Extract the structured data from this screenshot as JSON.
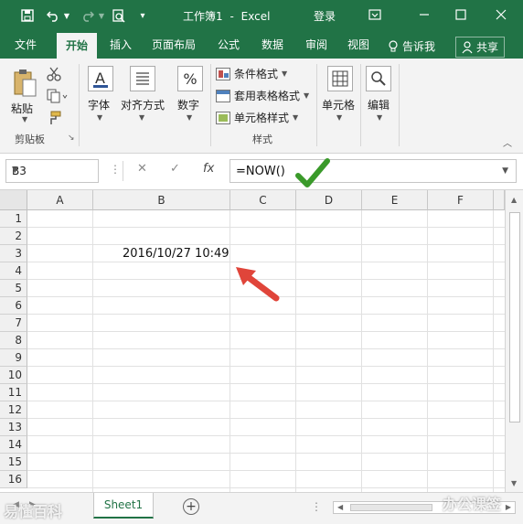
{
  "title_bar": {
    "doc_title": "工作簿1",
    "separator": "-",
    "app_name": "Excel",
    "login": "登录",
    "bg_color": "#217346"
  },
  "tabs": [
    {
      "label": "文件"
    },
    {
      "label": "开始",
      "active": true
    },
    {
      "label": "插入"
    },
    {
      "label": "页面布局"
    },
    {
      "label": "公式"
    },
    {
      "label": "数据"
    },
    {
      "label": "审阅"
    },
    {
      "label": "视图"
    }
  ],
  "tell_me": "告诉我",
  "share": "共享",
  "ribbon": {
    "paste": "粘贴",
    "clipboard_group": "剪贴板",
    "font": "字体",
    "alignment": "对齐方式",
    "number": "数字",
    "number_symbol": "%",
    "conditional_format": "条件格式",
    "format_as_table": "套用表格格式",
    "cell_styles": "单元格样式",
    "styles_group": "样式",
    "cells": "单元格",
    "editing": "编辑"
  },
  "formula_bar": {
    "name_box": "B3",
    "fx": "fx",
    "formula": "=NOW()"
  },
  "grid": {
    "columns": [
      "A",
      "B",
      "C",
      "D",
      "E",
      "F"
    ],
    "rows": [
      "1",
      "2",
      "3",
      "4",
      "5",
      "6",
      "7",
      "8",
      "9",
      "10",
      "11",
      "12",
      "13",
      "14",
      "15",
      "16"
    ],
    "cell_b3": "2016/10/27 10:49"
  },
  "sheet_tab": "Sheet1",
  "watermarks": {
    "left": "易懂百科",
    "right": "办公课签"
  }
}
